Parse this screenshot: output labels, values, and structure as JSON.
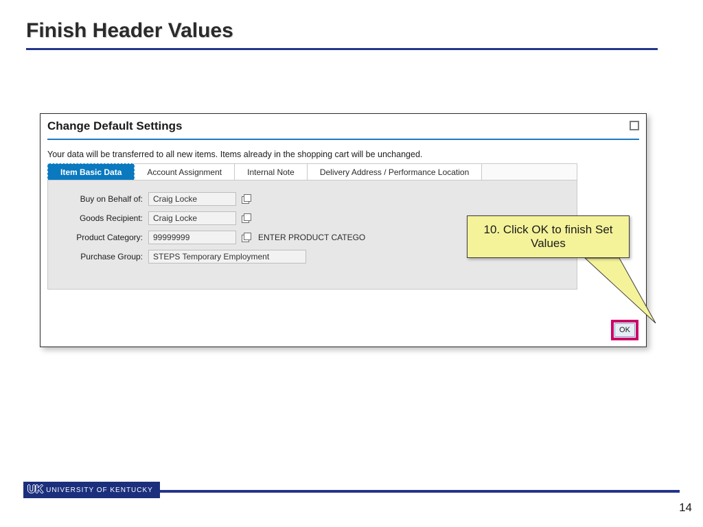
{
  "slide": {
    "title": "Finish Header Values",
    "page_number": "14"
  },
  "window": {
    "title": "Change Default Settings",
    "info": "Your data will be transferred to all new items. Items already in the shopping cart will be unchanged.",
    "tabs": [
      {
        "label": "Item Basic Data",
        "active": true
      },
      {
        "label": "Account Assignment",
        "active": false
      },
      {
        "label": "Internal Note",
        "active": false
      },
      {
        "label": "Delivery Address / Performance Location",
        "active": false
      }
    ],
    "form": {
      "buy_on_behalf_label": "Buy on Behalf of:",
      "buy_on_behalf_value": "Craig Locke",
      "goods_recipient_label": "Goods Recipient:",
      "goods_recipient_value": "Craig Locke",
      "product_category_label": "Product Category:",
      "product_category_value": "99999999",
      "product_category_help": "ENTER PRODUCT CATEGO",
      "purchase_group_label": "Purchase Group:",
      "purchase_group_value": "STEPS Temporary Employment"
    },
    "ok_label": "OK"
  },
  "callout": {
    "text": "10. Click OK to finish Set Values"
  },
  "footer": {
    "logo_mark": "UK",
    "logo_text": "UNIVERSITY OF KENTUCKY"
  }
}
